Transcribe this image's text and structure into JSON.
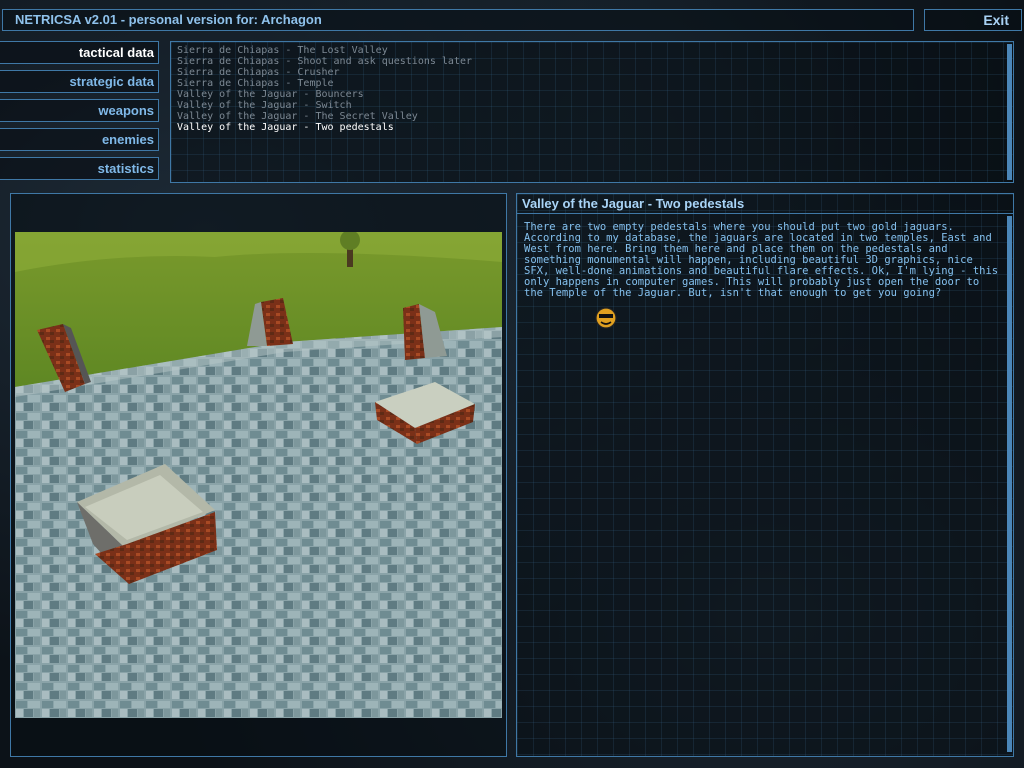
{
  "window": {
    "title": "NETRICSA v2.01 - personal version for: Archagon",
    "exit_label": "Exit"
  },
  "menu": [
    {
      "label": "tactical data",
      "active": true
    },
    {
      "label": "strategic data",
      "active": false
    },
    {
      "label": "weapons",
      "active": false
    },
    {
      "label": "enemies",
      "active": false
    },
    {
      "label": "statistics",
      "active": false
    }
  ],
  "missions": [
    "Sierra de Chiapas - The Lost Valley",
    "Sierra de Chiapas - Shoot and ask questions later",
    "Sierra de Chiapas - Crusher",
    "Sierra de Chiapas - Temple",
    "Valley of the Jaguar - Bouncers",
    "Valley of the Jaguar - Switch",
    "Valley of the Jaguar - The Secret Valley",
    "Valley of the Jaguar - Two pedestals"
  ],
  "selected_mission_index": 7,
  "detail": {
    "title": "Valley of the Jaguar - Two pedestals",
    "body": "There are two empty pedestals where you should put two gold jaguars. According to my database, the jaguars are located in two temples, East and West from here. Bring them here and place them on the pedestals and something monumental will happen, including beautiful 3D graphics, nice SFX, well-done animations and beautiful flare effects. Ok, I'm lying - this only happens in computer games. This will probably just open the door to the Temple of the Jaguar. But, isn't that enough to get you going?"
  },
  "colors": {
    "accent": "#3f78a6",
    "text": "#84c0ee",
    "selected": "#ffffff",
    "dim": "#7c8893"
  },
  "icons": {
    "cursor": "serious-sam-face-cursor-icon",
    "exit": "exit-button"
  }
}
